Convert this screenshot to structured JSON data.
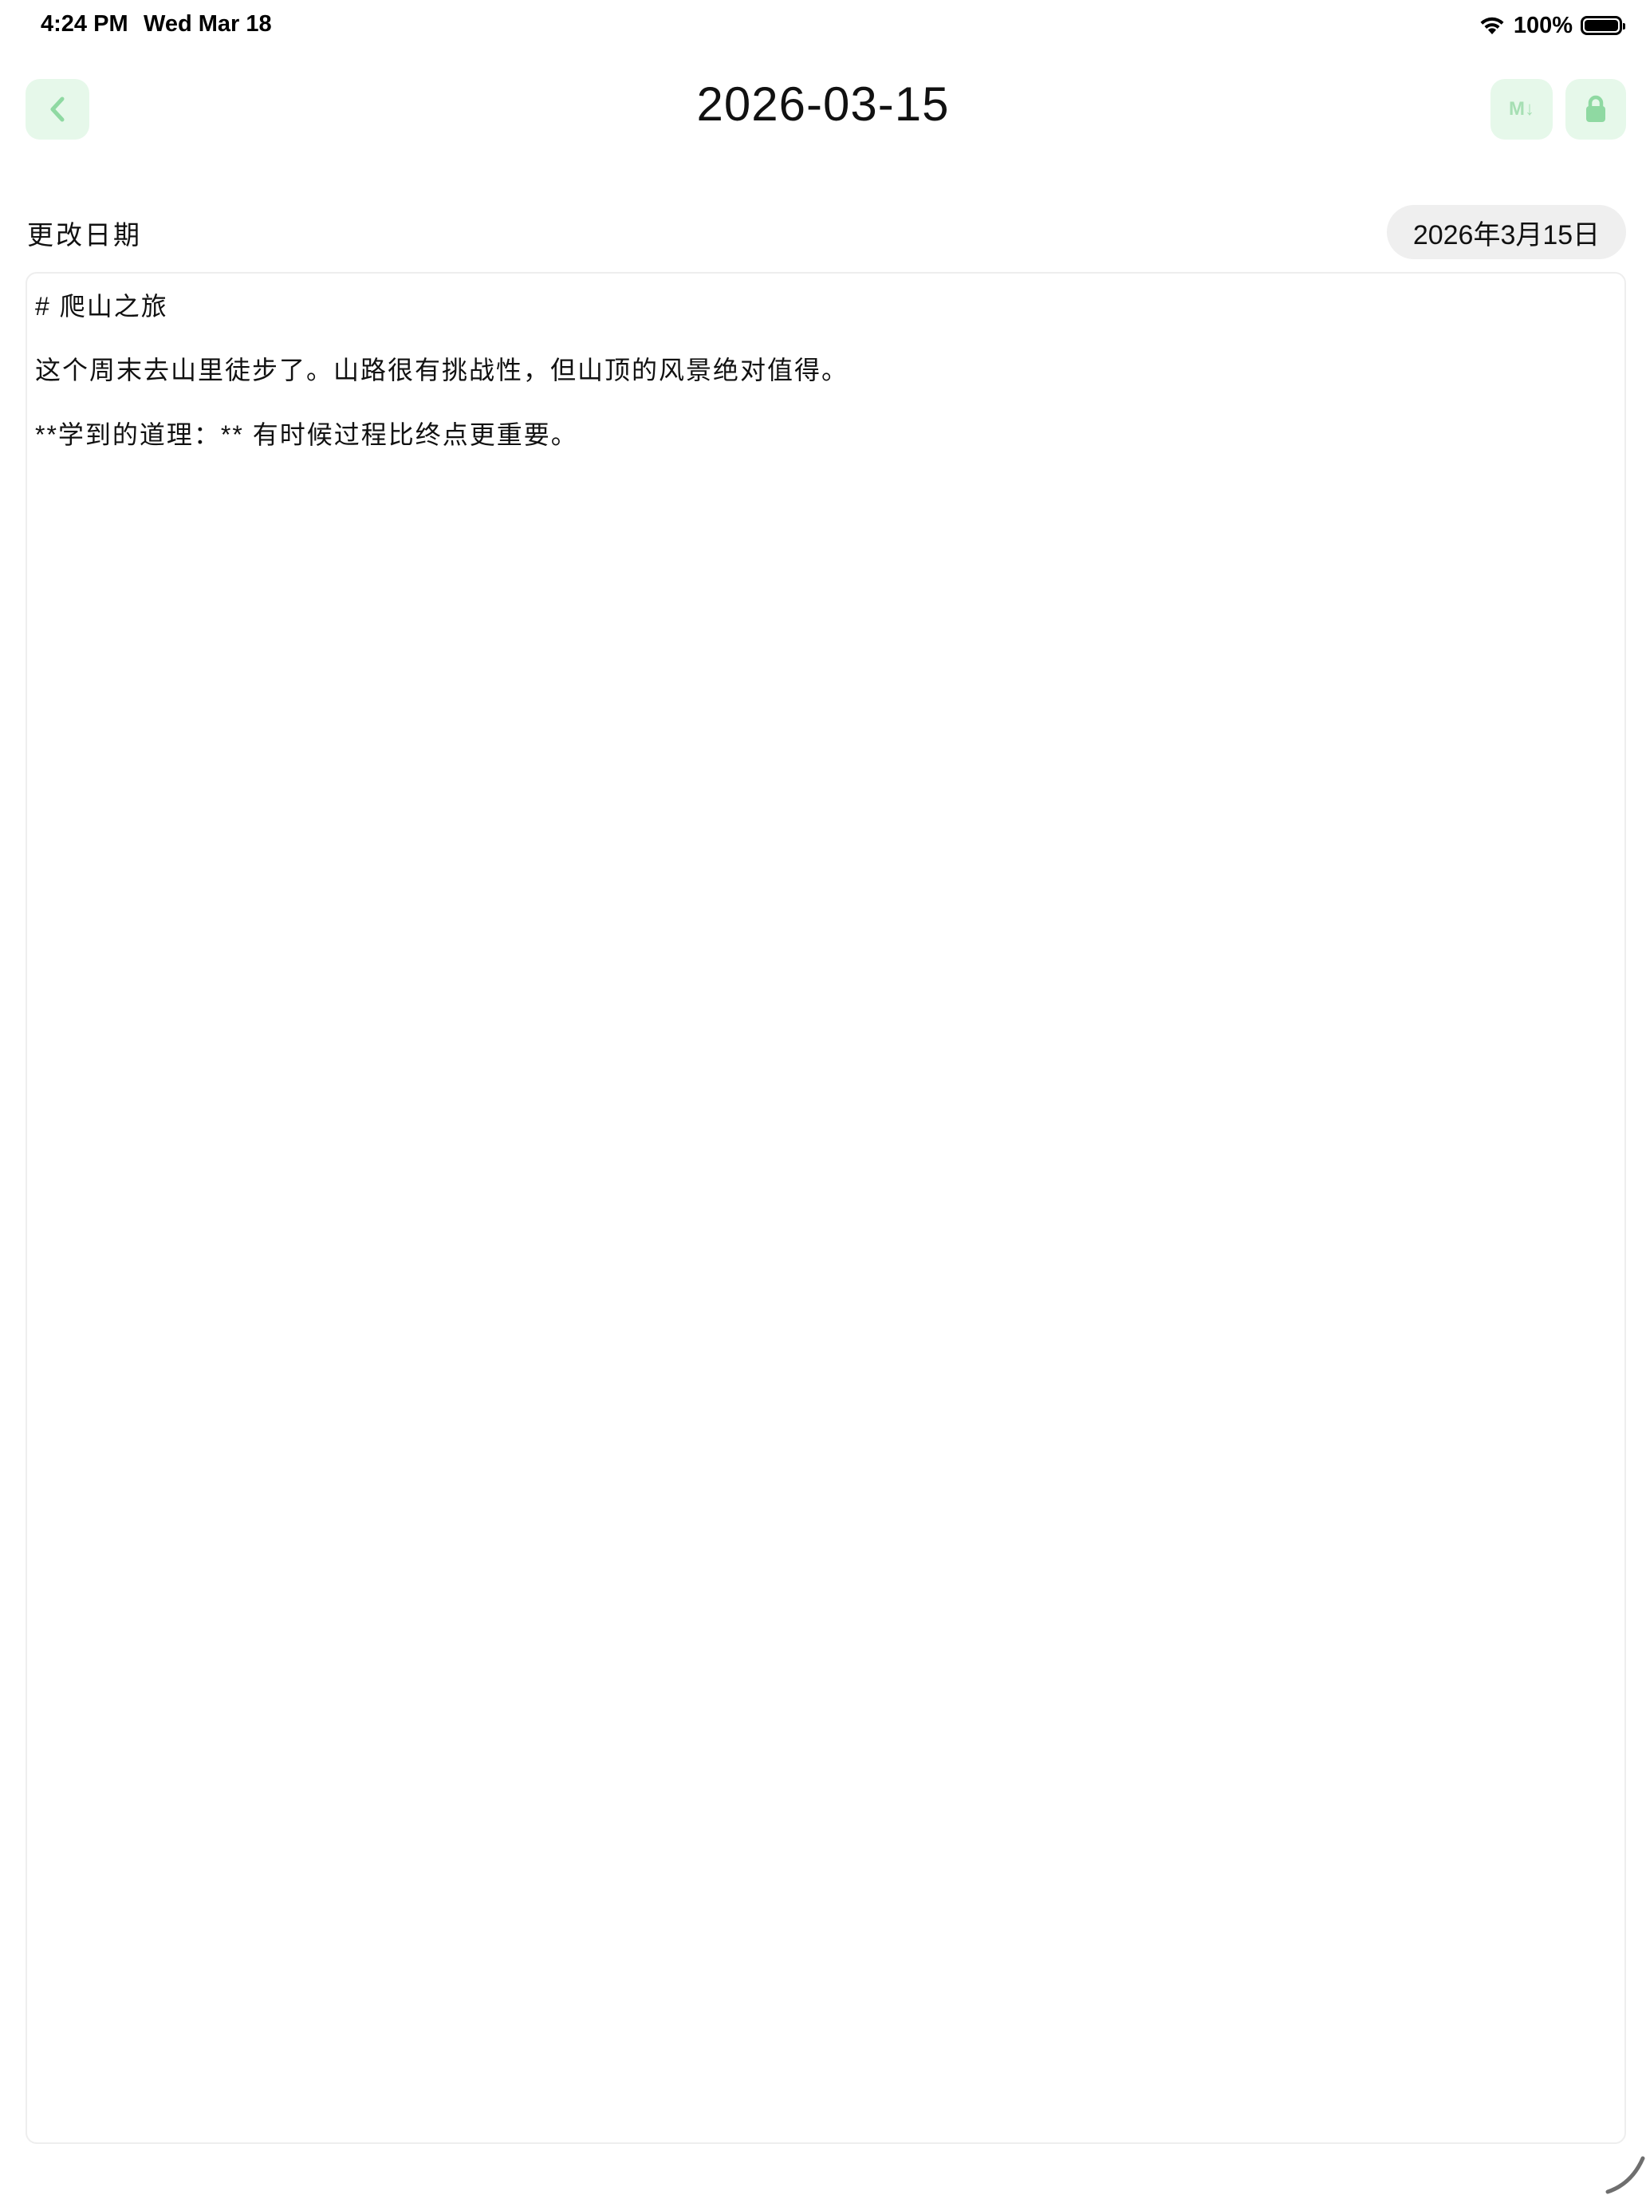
{
  "status_bar": {
    "time": "4:24 PM",
    "date": "Wed Mar 18",
    "battery_percent": "100%",
    "battery_level": 1.0,
    "icons": [
      "wifi-icon",
      "battery-icon"
    ]
  },
  "nav": {
    "title": "2026-03-15",
    "back_icon": "chevron-left-icon",
    "markdown_button_label": "M↓",
    "lock_icon": "lock-icon"
  },
  "date_row": {
    "label": "更改日期",
    "value": "2026年3月15日"
  },
  "editor": {
    "lines": [
      "# 爬山之旅",
      "这个周末去山里徒步了。山路很有挑战性，但山顶的风景绝对值得。",
      "**学到的道理：** 有时候过程比终点更重要。"
    ]
  },
  "colors": {
    "accent_bg": "#e6f8ea",
    "accent_fg": "#8fd9a2",
    "pill_bg": "#efefef",
    "editor_border": "#eeeeee"
  }
}
